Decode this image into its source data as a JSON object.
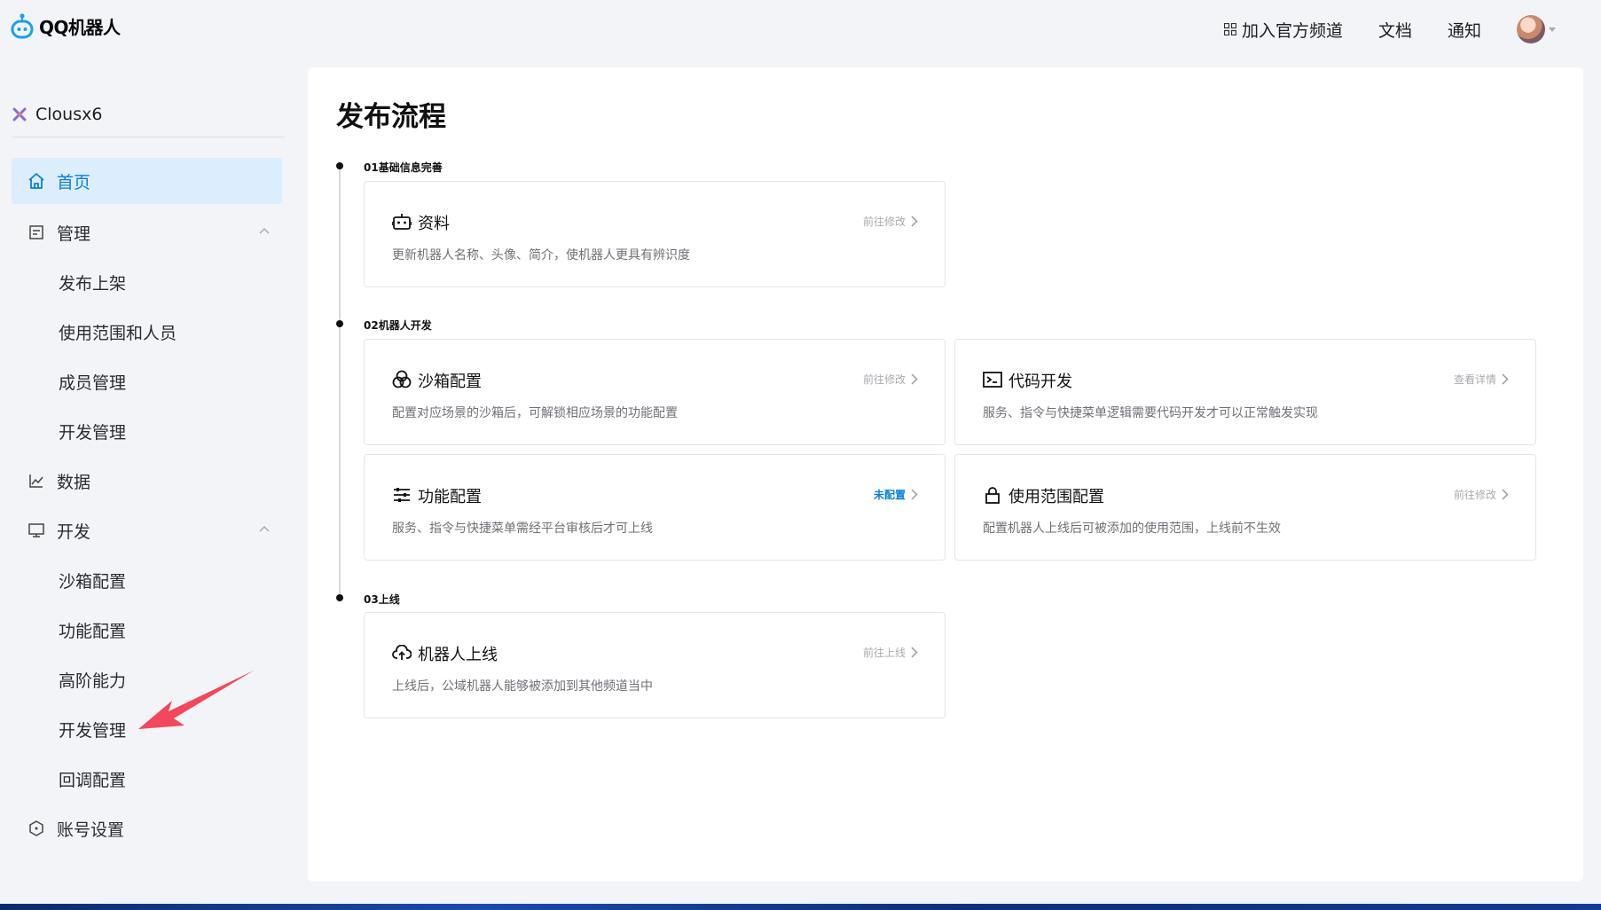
{
  "app": {
    "logo_text": "QQ机器人"
  },
  "header": {
    "join_channel": "加入官方频道",
    "docs": "文档",
    "notify": "通知"
  },
  "sidebar": {
    "bot_name": "Clousx6",
    "items": [
      {
        "label": "首页",
        "icon": "home-icon",
        "active": true
      },
      {
        "label": "管理",
        "icon": "document-icon",
        "expandable": true
      },
      {
        "label": "发布上架",
        "sub": true
      },
      {
        "label": "使用范围和人员",
        "sub": true
      },
      {
        "label": "成员管理",
        "sub": true
      },
      {
        "label": "开发管理",
        "sub": true
      },
      {
        "label": "数据",
        "icon": "line-chart-icon"
      },
      {
        "label": "开发",
        "icon": "monitor-icon",
        "expandable": true
      },
      {
        "label": "沙箱配置",
        "sub": true
      },
      {
        "label": "功能配置",
        "sub": true
      },
      {
        "label": "高阶能力",
        "sub": true
      },
      {
        "label": "开发管理",
        "sub": true
      },
      {
        "label": "回调配置",
        "sub": true
      },
      {
        "label": "账号设置",
        "icon": "hexagon-icon"
      }
    ]
  },
  "main": {
    "title": "发布流程",
    "steps": [
      {
        "label": "01基础信息完善"
      },
      {
        "label": "02机器人开发"
      },
      {
        "label": "03上线"
      }
    ],
    "cards": [
      {
        "title": "资料",
        "desc": "更新机器人名称、头像、简介，使机器人更具有辨识度",
        "action": "前往修改",
        "icon": "robot-icon"
      },
      {
        "title": "沙箱配置",
        "desc": "配置对应场景的沙箱后，可解锁相应场景的功能配置",
        "action": "前往修改",
        "icon": "circles-icon"
      },
      {
        "title": "代码开发",
        "desc": "服务、指令与快捷菜单逻辑需要代码开发才可以正常触发实现",
        "action": "查看详情",
        "icon": "terminal-icon"
      },
      {
        "title": "功能配置",
        "desc": "服务、指令与快捷菜单需经平台审核后才可上线",
        "action": "未配置",
        "icon": "sliders-icon",
        "highlight": true
      },
      {
        "title": "使用范围配置",
        "desc": "配置机器人上线后可被添加的使用范围，上线前不生效",
        "action": "前往修改",
        "icon": "lock-icon"
      },
      {
        "title": "机器人上线",
        "desc": "上线后，公域机器人能够被添加到其他频道当中",
        "action": "前往上线",
        "icon": "cloud-upload-icon"
      }
    ]
  },
  "colors": {
    "accent": "#0a7fd8",
    "active_bg": "#dcedfd",
    "annotation_arrow": "#f2475d"
  }
}
